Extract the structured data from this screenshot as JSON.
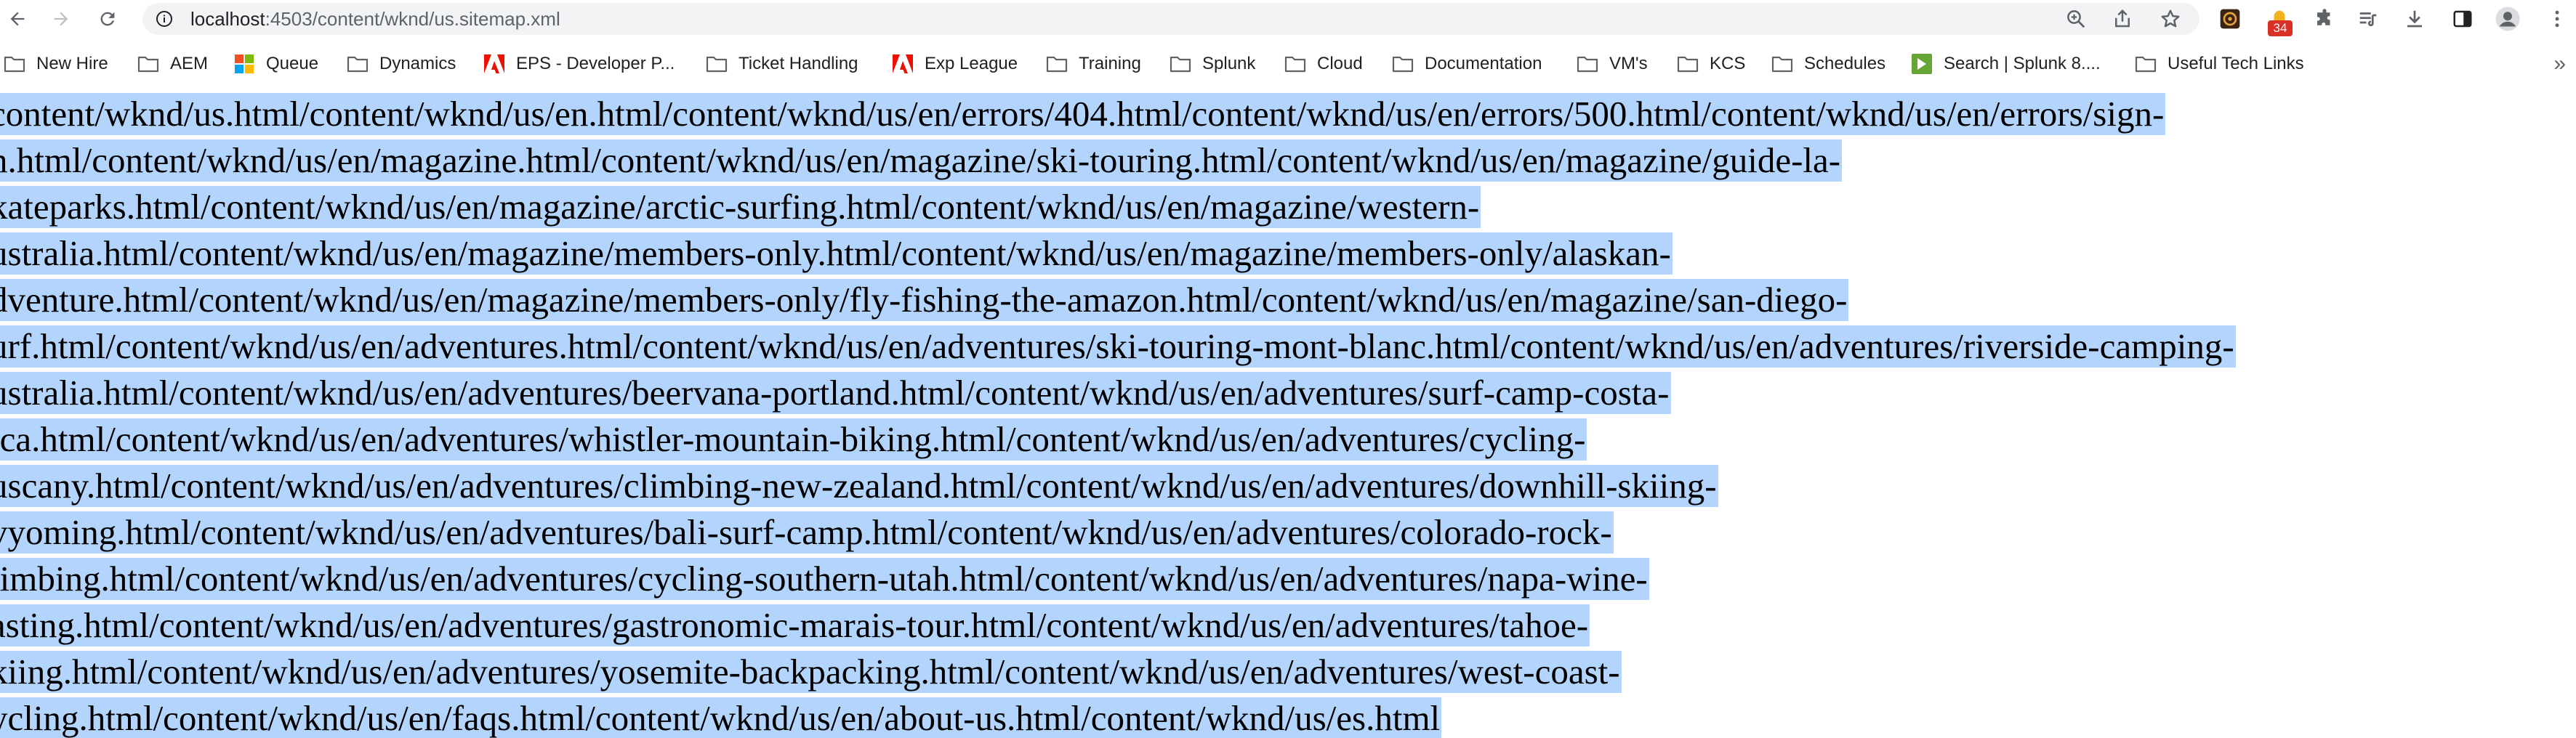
{
  "address_bar": {
    "host": "localhost",
    "rest": ":4503/content/wknd/us.sitemap.xml"
  },
  "extension_badge": "34",
  "bookmarks": [
    {
      "label": "New Hire",
      "icon": "folder-icon"
    },
    {
      "label": "AEM",
      "icon": "folder-icon"
    },
    {
      "label": "Queue",
      "icon": "microsoft-logo-icon"
    },
    {
      "label": "Dynamics",
      "icon": "folder-icon"
    },
    {
      "label": "EPS - Developer P...",
      "icon": "adobe-logo-icon"
    },
    {
      "label": "Ticket Handling",
      "icon": "folder-icon"
    },
    {
      "label": "Exp League",
      "icon": "adobe-logo-icon"
    },
    {
      "label": "Training",
      "icon": "folder-icon"
    },
    {
      "label": "Splunk",
      "icon": "folder-icon"
    },
    {
      "label": "Cloud",
      "icon": "folder-icon"
    },
    {
      "label": "Documentation",
      "icon": "folder-icon"
    },
    {
      "label": "VM's",
      "icon": "folder-icon"
    },
    {
      "label": "KCS",
      "icon": "folder-icon"
    },
    {
      "label": "Schedules",
      "icon": "folder-icon"
    },
    {
      "label": "Search | Splunk 8....",
      "icon": "splunk-logo-icon"
    },
    {
      "label": "Useful Tech Links",
      "icon": "folder-icon"
    }
  ],
  "overflow_label": "»",
  "content_lines": [
    "content/wknd/us.html/content/wknd/us/en.html/content/wknd/us/en/errors/404.html/content/wknd/us/en/errors/500.html/content/wknd/us/en/errors/sign-",
    "n.html/content/wknd/us/en/magazine.html/content/wknd/us/en/magazine/ski-touring.html/content/wknd/us/en/magazine/guide-la-",
    "kateparks.html/content/wknd/us/en/magazine/arctic-surfing.html/content/wknd/us/en/magazine/western-",
    "ustralia.html/content/wknd/us/en/magazine/members-only.html/content/wknd/us/en/magazine/members-only/alaskan-",
    "dventure.html/content/wknd/us/en/magazine/members-only/fly-fishing-the-amazon.html/content/wknd/us/en/magazine/san-diego-",
    "urf.html/content/wknd/us/en/adventures.html/content/wknd/us/en/adventures/ski-touring-mont-blanc.html/content/wknd/us/en/adventures/riverside-camping-",
    "ustralia.html/content/wknd/us/en/adventures/beervana-portland.html/content/wknd/us/en/adventures/surf-camp-costa-",
    "ica.html/content/wknd/us/en/adventures/whistler-mountain-biking.html/content/wknd/us/en/adventures/cycling-",
    "uscany.html/content/wknd/us/en/adventures/climbing-new-zealand.html/content/wknd/us/en/adventures/downhill-skiing-",
    "vyoming.html/content/wknd/us/en/adventures/bali-surf-camp.html/content/wknd/us/en/adventures/colorado-rock-",
    "limbing.html/content/wknd/us/en/adventures/cycling-southern-utah.html/content/wknd/us/en/adventures/napa-wine-",
    "asting.html/content/wknd/us/en/adventures/gastronomic-marais-tour.html/content/wknd/us/en/adventures/tahoe-",
    "kiing.html/content/wknd/us/en/adventures/yosemite-backpacking.html/content/wknd/us/en/adventures/west-coast-",
    "ycling.html/content/wknd/us/en/faqs.html/content/wknd/us/en/about-us.html/content/wknd/us/es.html"
  ]
}
